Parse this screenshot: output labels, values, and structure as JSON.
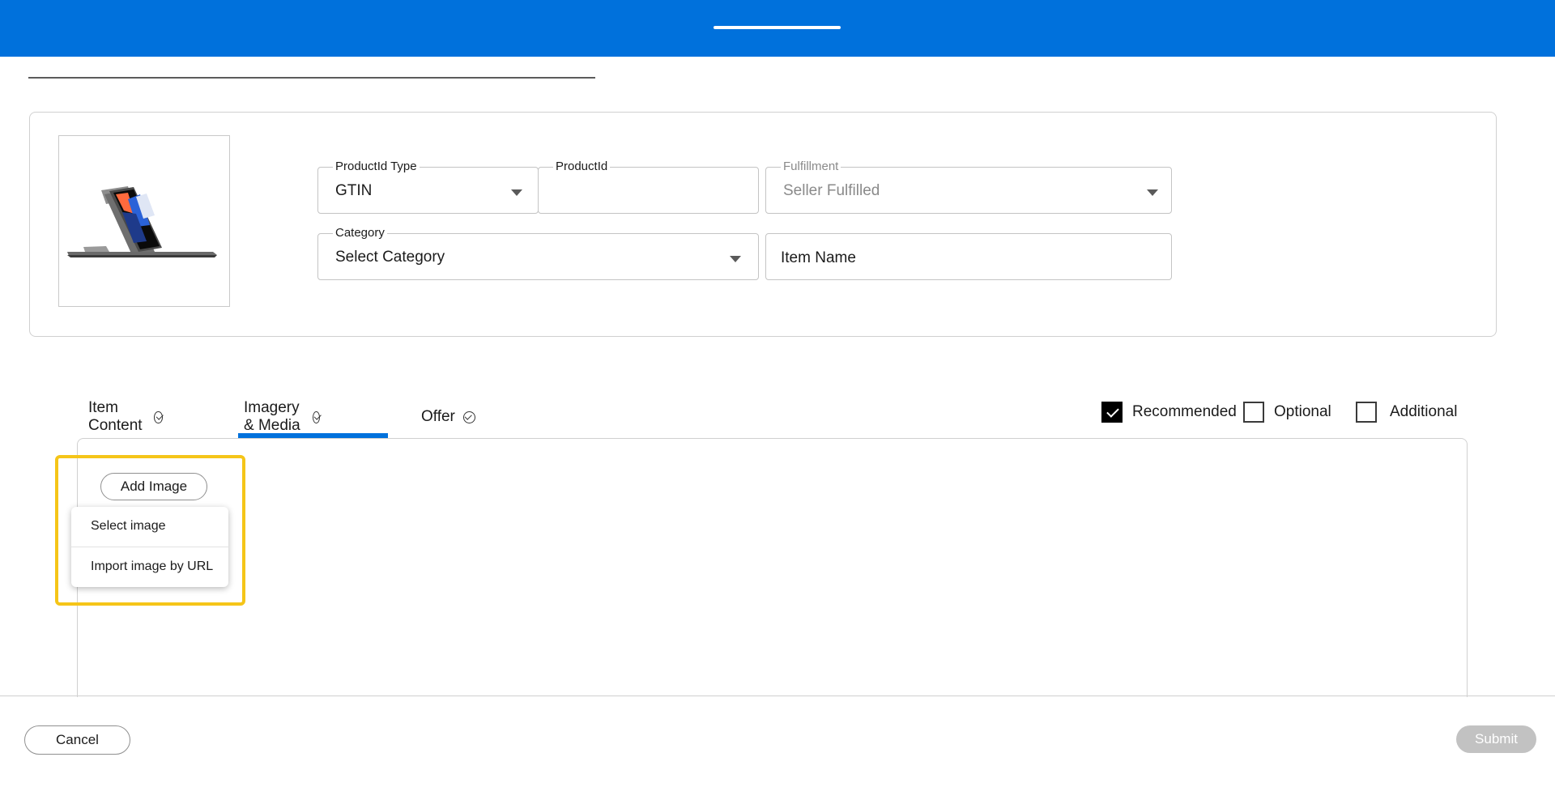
{
  "form": {
    "productid_type": {
      "label": "ProductId Type",
      "value": "GTIN"
    },
    "productid": {
      "label": "ProductId",
      "value": ""
    },
    "fulfillment": {
      "label": "Fulfillment",
      "value": "Seller Fulfilled"
    },
    "category": {
      "label": "Category",
      "value": "Select Category"
    },
    "item_name": {
      "placeholder": "Item Name"
    }
  },
  "tabs": [
    {
      "label": "Item Content",
      "complete": true
    },
    {
      "label": "Imagery & Media",
      "complete": true,
      "active": true
    },
    {
      "label": "Offer",
      "complete": true
    }
  ],
  "filters": {
    "recommended": {
      "label": "Recommended",
      "checked": true
    },
    "optional": {
      "label": "Optional",
      "checked": false
    },
    "additional": {
      "label": "Additional",
      "checked": false
    }
  },
  "media": {
    "add_image_label": "Add Image",
    "menu": [
      "Select image",
      "Import image by URL"
    ]
  },
  "footer": {
    "cancel_label": "Cancel",
    "submit_label": "Submit"
  },
  "colors": {
    "brand_blue": "#0071dc",
    "highlight": "#f5c518",
    "disabled": "#c2c2c2"
  }
}
